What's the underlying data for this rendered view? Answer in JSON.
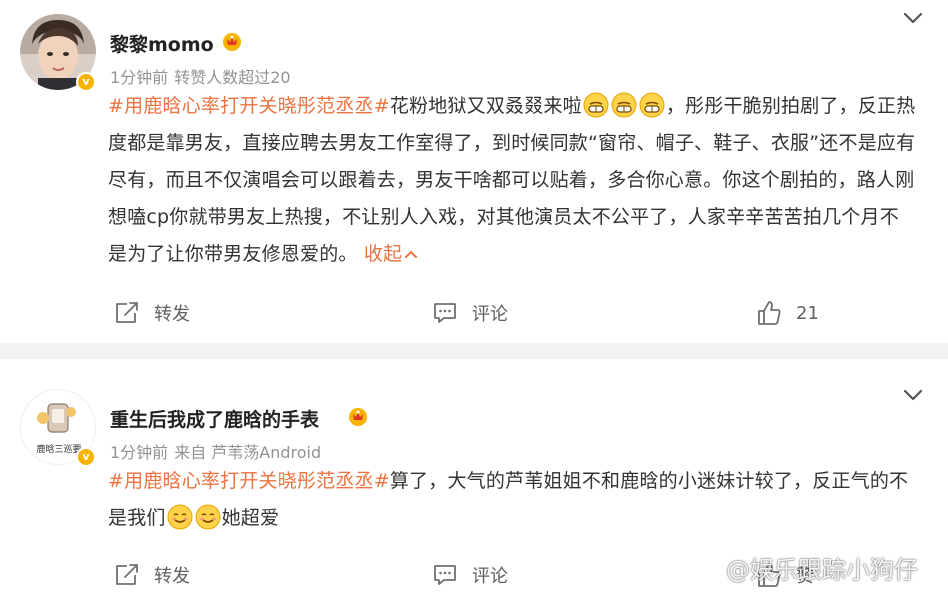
{
  "posts": [
    {
      "username": "黎黎momo",
      "time": "1分钟前",
      "meta_note": "转赞人数超过20",
      "hashtag": "#用鹿晗心率打开关晓彤范丞丞#",
      "text_before_emoji": "花粉地狱又双叒叕来啦",
      "text_after_emoji": "，彤彤干脆别拍剧了，反正热度都是靠男友，直接应聘去男友工作室得了，到时候同款“窗帘、帽子、鞋子、衣服”还不是应有尽有，而且不仅演唱会可以跟着去，男友干啥都可以贴着，多合你心意。你这个剧拍的，路人刚想嗑cp你就带男友上热搜，不让别人入戏，对其他演员太不公平了，人家辛辛苦苦拍几个月不是为了让你带男友修恩爱的。",
      "collapse_label": "收起",
      "emoji": [
        "grin-emoji",
        "grin-emoji",
        "grin-emoji"
      ],
      "repost_label": "转发",
      "comment_label": "评论",
      "like_count": "21"
    },
    {
      "username": "重生后我成了鹿晗的手表",
      "time": "1分钟前",
      "source": "来自 芦苇荡Android",
      "avatar_text": "鹿晗三巡要",
      "hashtag": "#用鹿晗心率打开关晓彤范丞丞#",
      "text_before_emoji": "算了，大气的芦苇姐姐不和鹿晗的小迷妹计较了，反正气的不是我们",
      "text_after_emoji": "她超爱",
      "emoji": [
        "smile-emoji",
        "smile-emoji"
      ],
      "repost_label": "转发",
      "comment_label": "评论",
      "like_label": "赞"
    }
  ],
  "watermark": "@娱乐跟踪小狗仔",
  "colors": {
    "hashtag": "#eb7340",
    "meta": "#939393",
    "text": "#333333",
    "separator": "#f2f2f2",
    "badge": "#f6b400"
  }
}
